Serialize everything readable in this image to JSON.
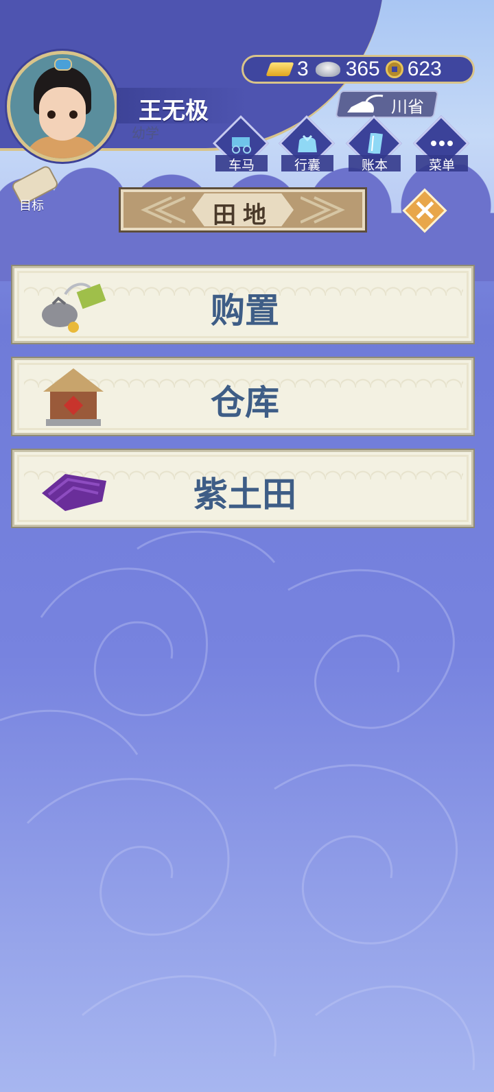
{
  "player": {
    "name": "王无极",
    "rank": "幼学"
  },
  "currency": {
    "gold": "3",
    "silver": "365",
    "copper": "623",
    "icons": [
      "gold-ingot-icon",
      "silver-ingot-icon",
      "copper-coin-icon"
    ]
  },
  "region": {
    "label": "川省",
    "icon": "iron-icon"
  },
  "menu": [
    {
      "label": "车马",
      "icon": "carriage-icon"
    },
    {
      "label": "行囊",
      "icon": "bundle-icon"
    },
    {
      "label": "账本",
      "icon": "ledger-icon"
    },
    {
      "label": "菜单",
      "icon": "more-icon"
    }
  ],
  "goal": {
    "label": "目标",
    "icon": "scroll-icon"
  },
  "panel": {
    "title": "田地",
    "close_icon": "close-icon"
  },
  "items": [
    {
      "label": "购置",
      "icon": "purchase-icon"
    },
    {
      "label": "仓库",
      "icon": "warehouse-icon"
    },
    {
      "label": "紫土田",
      "icon": "purple-field-icon"
    }
  ],
  "colors": {
    "primary": "#3b4299",
    "gold_border": "#d9c48a",
    "card_text": "#3e5d86",
    "card_bg": "#f3f1e2",
    "close_button": "#e8a64a"
  }
}
